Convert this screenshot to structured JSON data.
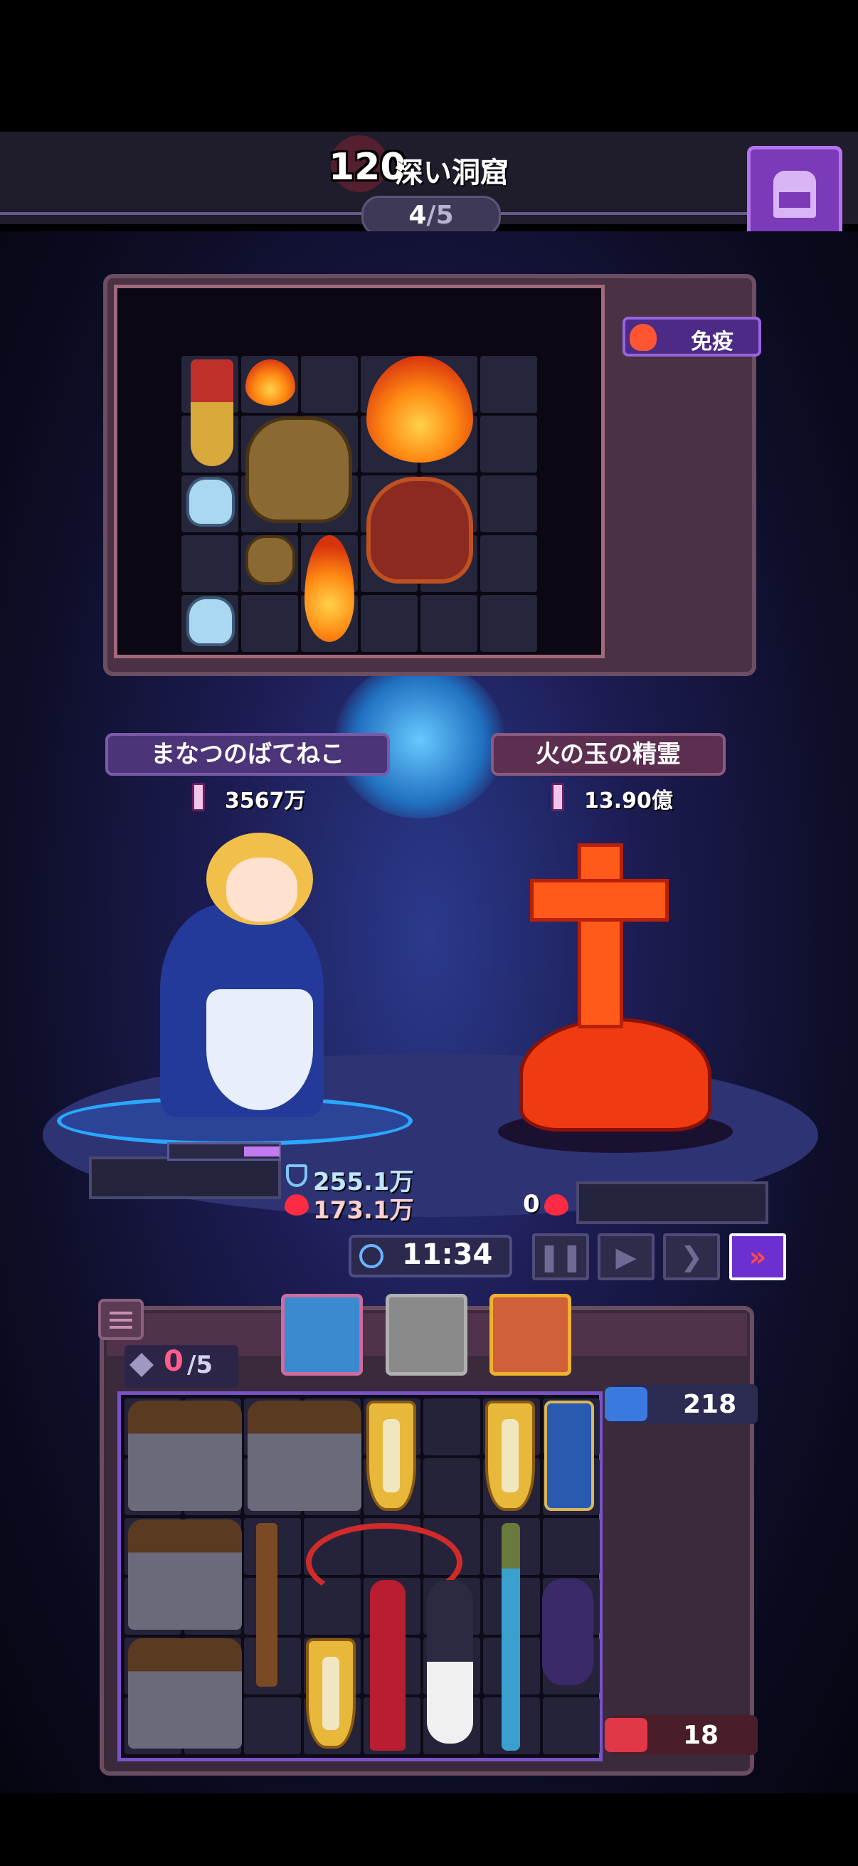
{
  "header": {
    "stage_number": "120",
    "stage_name": "深い洞窟",
    "progress_current": "4",
    "progress_sep": "/",
    "progress_total": "5",
    "bag_icon": "backpack-icon"
  },
  "enemy_bag": {
    "status_badge": "免疫",
    "status_icon": "poison-flask-icon"
  },
  "player": {
    "name": "まなつのばてねこ",
    "power": "3567万",
    "shield": "255.1万",
    "hp": "173.1万"
  },
  "enemy": {
    "name": "火の玉の精霊",
    "power": "13.90億",
    "hp": "0"
  },
  "battle_controls": {
    "timer": "11:34",
    "pause": "❚❚",
    "play": "▶",
    "fast": "❯",
    "fastest": "»"
  },
  "player_bag": {
    "slots_current": "0",
    "slots_total": "/5",
    "attack_count": "218",
    "poison_count": "18"
  },
  "colors": {
    "accent_purple": "#7b3ab8",
    "fast_button": "#6c2fd0",
    "slots_red": "#ff5d8a"
  }
}
